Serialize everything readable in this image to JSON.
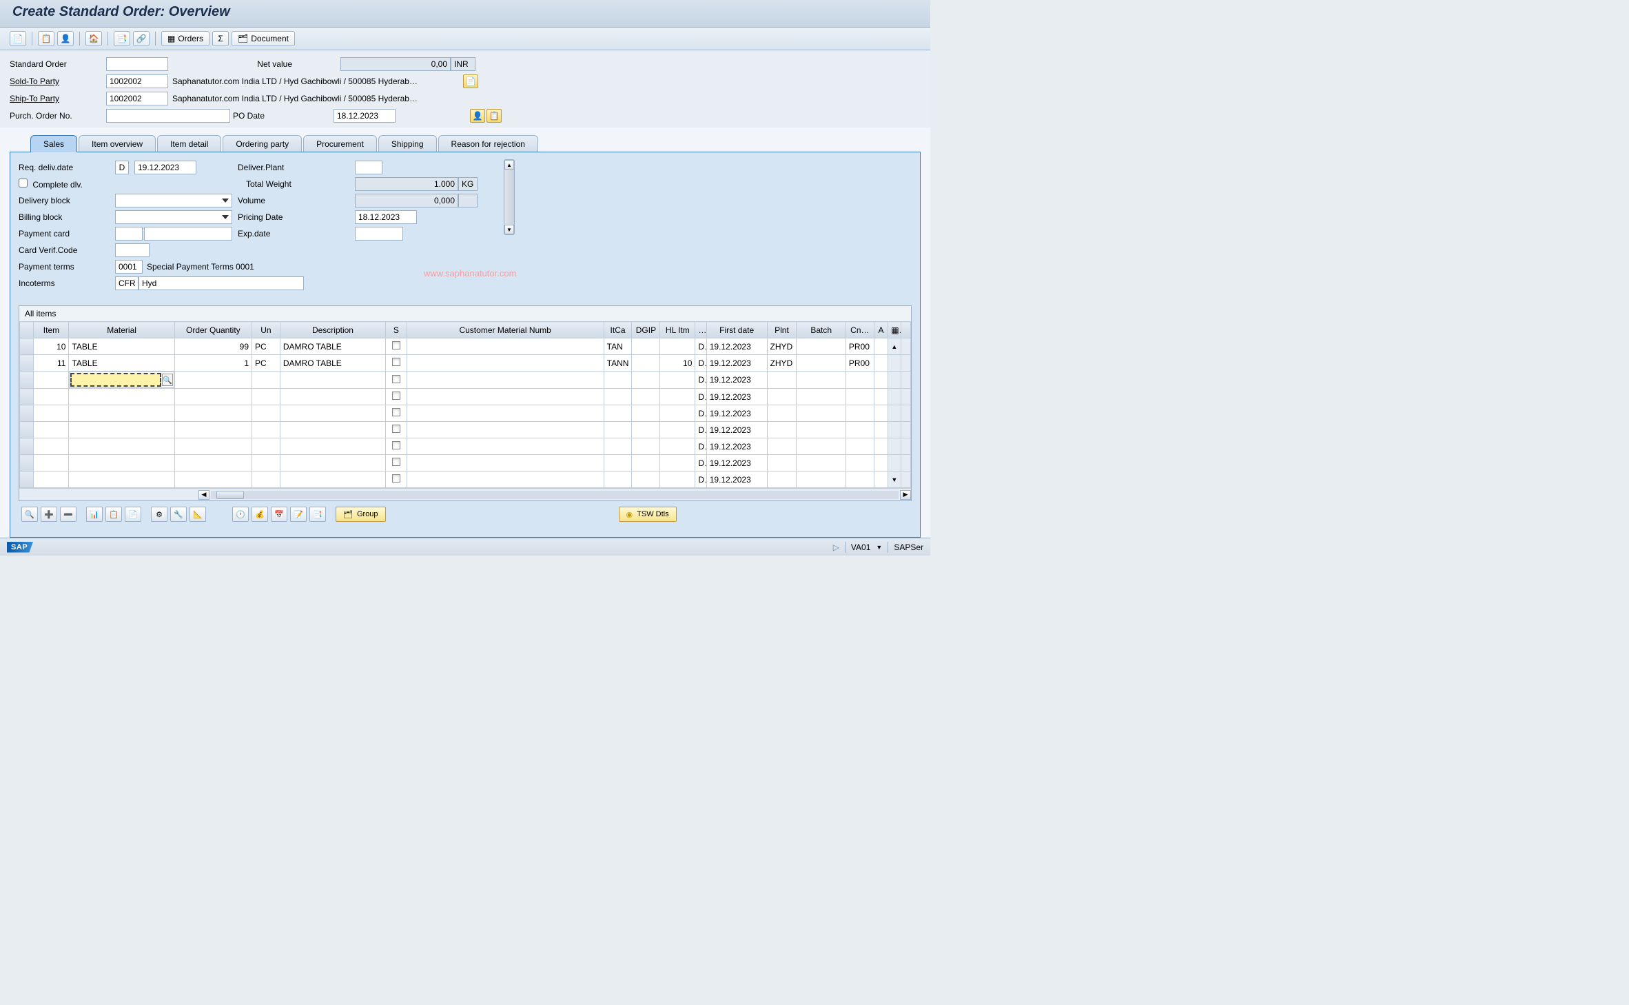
{
  "title": "Create Standard Order: Overview",
  "toolbar_buttons": {
    "orders_label": "Orders",
    "sigma_label": "Σ",
    "document_label": "Document"
  },
  "header": {
    "standard_order_label": "Standard Order",
    "standard_order_value": "",
    "net_value_label": "Net value",
    "net_value": "0,00",
    "currency": "INR",
    "sold_to_label": "Sold-To Party",
    "sold_to_code": "1002002",
    "sold_to_text": "Saphanatutor.com India LTD / Hyd Gachibowli / 500085 Hyderab…",
    "ship_to_label": "Ship-To Party",
    "ship_to_code": "1002002",
    "ship_to_text": "Saphanatutor.com India LTD / Hyd Gachibowli / 500085 Hyderab…",
    "po_no_label": "Purch. Order No.",
    "po_no_value": "",
    "po_date_label": "PO Date",
    "po_date_value": "18.12.2023"
  },
  "tabs": [
    "Sales",
    "Item overview",
    "Item detail",
    "Ordering party",
    "Procurement",
    "Shipping",
    "Reason for rejection"
  ],
  "active_tab": "Sales",
  "sales": {
    "req_deliv_date_label": "Req. deliv.date",
    "req_deliv_date_type": "D",
    "req_deliv_date": "19.12.2023",
    "deliver_plant_label": "Deliver.Plant",
    "deliver_plant": "",
    "complete_dlv_label": "Complete dlv.",
    "complete_dlv_checked": false,
    "total_weight_label": "Total Weight",
    "total_weight": "1.000",
    "weight_unit": "KG",
    "delivery_block_label": "Delivery block",
    "delivery_block": "",
    "volume_label": "Volume",
    "volume": "0,000",
    "volume_unit": "",
    "billing_block_label": "Billing block",
    "billing_block": "",
    "pricing_date_label": "Pricing Date",
    "pricing_date": "18.12.2023",
    "payment_card_label": "Payment card",
    "payment_card": "",
    "payment_card2": "",
    "exp_date_label": "Exp.date",
    "exp_date": "",
    "card_verif_label": "Card Verif.Code",
    "card_verif": "",
    "payment_terms_label": "Payment terms",
    "payment_terms_code": "0001",
    "payment_terms_text": "Special Payment Terms 0001",
    "incoterms_label": "Incoterms",
    "incoterms_code": "CFR",
    "incoterms_text": "Hyd"
  },
  "watermark": "www.saphanatutor.com",
  "grid": {
    "title": "All items",
    "columns": [
      "Item",
      "Material",
      "Order Quantity",
      "Un",
      "Description",
      "S",
      "Customer Material Numb",
      "ItCa",
      "DGIP",
      "HL Itm",
      "…",
      "First date",
      "Plnt",
      "Batch",
      "Cn…",
      "A"
    ],
    "rows": [
      {
        "item": "10",
        "material": "TABLE",
        "qty": "99",
        "un": "PC",
        "desc": "DAMRO TABLE",
        "cmat": "",
        "itca": "TAN",
        "dgip": "",
        "hlitm": "",
        "dtype": "D",
        "first_date": "19.12.2023",
        "plnt": "ZHYD",
        "batch": "",
        "cn": "PR00"
      },
      {
        "item": "11",
        "material": "TABLE",
        "qty": "1",
        "un": "PC",
        "desc": "DAMRO TABLE",
        "cmat": "",
        "itca": "TANN",
        "dgip": "",
        "hlitm": "10",
        "dtype": "D",
        "first_date": "19.12.2023",
        "plnt": "ZHYD",
        "batch": "",
        "cn": "PR00"
      },
      {
        "item": "",
        "material": "__INPUT__",
        "qty": "",
        "un": "",
        "desc": "",
        "cmat": "",
        "itca": "",
        "dgip": "",
        "hlitm": "",
        "dtype": "D",
        "first_date": "19.12.2023",
        "plnt": "",
        "batch": "",
        "cn": ""
      },
      {
        "item": "",
        "material": "",
        "qty": "",
        "un": "",
        "desc": "",
        "cmat": "",
        "itca": "",
        "dgip": "",
        "hlitm": "",
        "dtype": "D",
        "first_date": "19.12.2023",
        "plnt": "",
        "batch": "",
        "cn": ""
      },
      {
        "item": "",
        "material": "",
        "qty": "",
        "un": "",
        "desc": "",
        "cmat": "",
        "itca": "",
        "dgip": "",
        "hlitm": "",
        "dtype": "D",
        "first_date": "19.12.2023",
        "plnt": "",
        "batch": "",
        "cn": ""
      },
      {
        "item": "",
        "material": "",
        "qty": "",
        "un": "",
        "desc": "",
        "cmat": "",
        "itca": "",
        "dgip": "",
        "hlitm": "",
        "dtype": "D",
        "first_date": "19.12.2023",
        "plnt": "",
        "batch": "",
        "cn": ""
      },
      {
        "item": "",
        "material": "",
        "qty": "",
        "un": "",
        "desc": "",
        "cmat": "",
        "itca": "",
        "dgip": "",
        "hlitm": "",
        "dtype": "D",
        "first_date": "19.12.2023",
        "plnt": "",
        "batch": "",
        "cn": ""
      },
      {
        "item": "",
        "material": "",
        "qty": "",
        "un": "",
        "desc": "",
        "cmat": "",
        "itca": "",
        "dgip": "",
        "hlitm": "",
        "dtype": "D",
        "first_date": "19.12.2023",
        "plnt": "",
        "batch": "",
        "cn": ""
      },
      {
        "item": "",
        "material": "",
        "qty": "",
        "un": "",
        "desc": "",
        "cmat": "",
        "itca": "",
        "dgip": "",
        "hlitm": "",
        "dtype": "D",
        "first_date": "19.12.2023",
        "plnt": "",
        "batch": "",
        "cn": ""
      }
    ]
  },
  "grid_buttons": {
    "group_label": "Group",
    "tsw_label": "TSW Dtls"
  },
  "status": {
    "tcode": "VA01",
    "server": "SAPSer"
  }
}
